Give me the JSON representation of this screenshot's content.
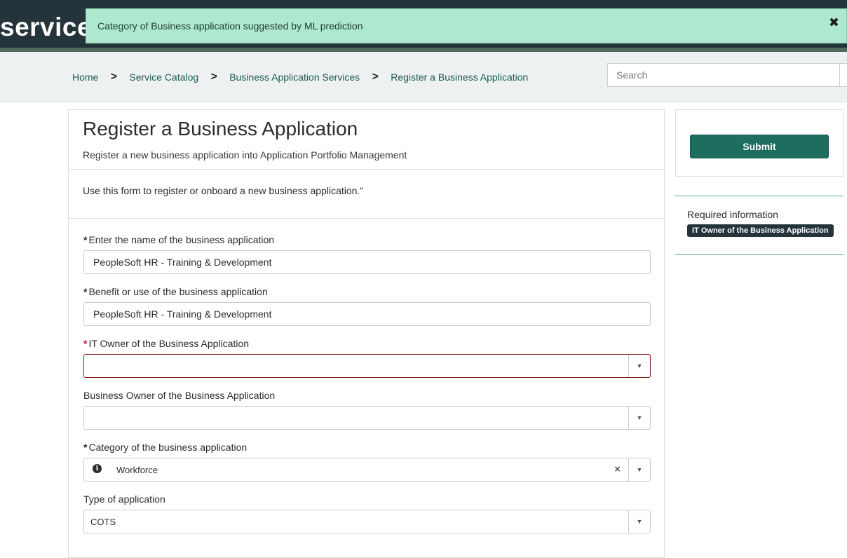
{
  "header": {
    "logo_text": "service",
    "notification": "Category of Business application suggested by ML prediction",
    "close_icon": "close-icon"
  },
  "breadcrumb": {
    "items": [
      "Home",
      "Service Catalog",
      "Business Application Services",
      "Register a Business Application"
    ],
    "separator": ">"
  },
  "search": {
    "placeholder": "Search"
  },
  "form": {
    "title": "Register a Business Application",
    "subtitle": "Register a new business application into Application Portfolio Management",
    "intro": "Use this form to register or onboard a new business application.”",
    "fields": {
      "app_name": {
        "label": "Enter the name of the business application",
        "required": "*",
        "value": "PeopleSoft HR - Training & Development"
      },
      "benefit": {
        "label": "Benefit or use of the business application",
        "required": "*",
        "value": "PeopleSoft HR - Training & Development"
      },
      "it_owner": {
        "label": "IT Owner of the Business Application",
        "required": "*",
        "value": ""
      },
      "business_owner": {
        "label": "Business Owner of the Business Application",
        "value": ""
      },
      "category": {
        "label": "Category of the business application",
        "required": "*",
        "value": "Workforce",
        "clear": "×"
      },
      "type": {
        "label": "Type of application",
        "value": "COTS"
      }
    },
    "dropdown_arrow": "▼"
  },
  "sidebar": {
    "submit_label": "Submit",
    "required_info_label": "Required information",
    "required_badges": [
      "IT Owner of the Business Application"
    ]
  },
  "colors": {
    "header_bg": "#24343a",
    "alert_bg": "#aee8cf",
    "link": "#1c5b4d",
    "primary_button": "#1e6e5f",
    "error": "#c8102e"
  }
}
